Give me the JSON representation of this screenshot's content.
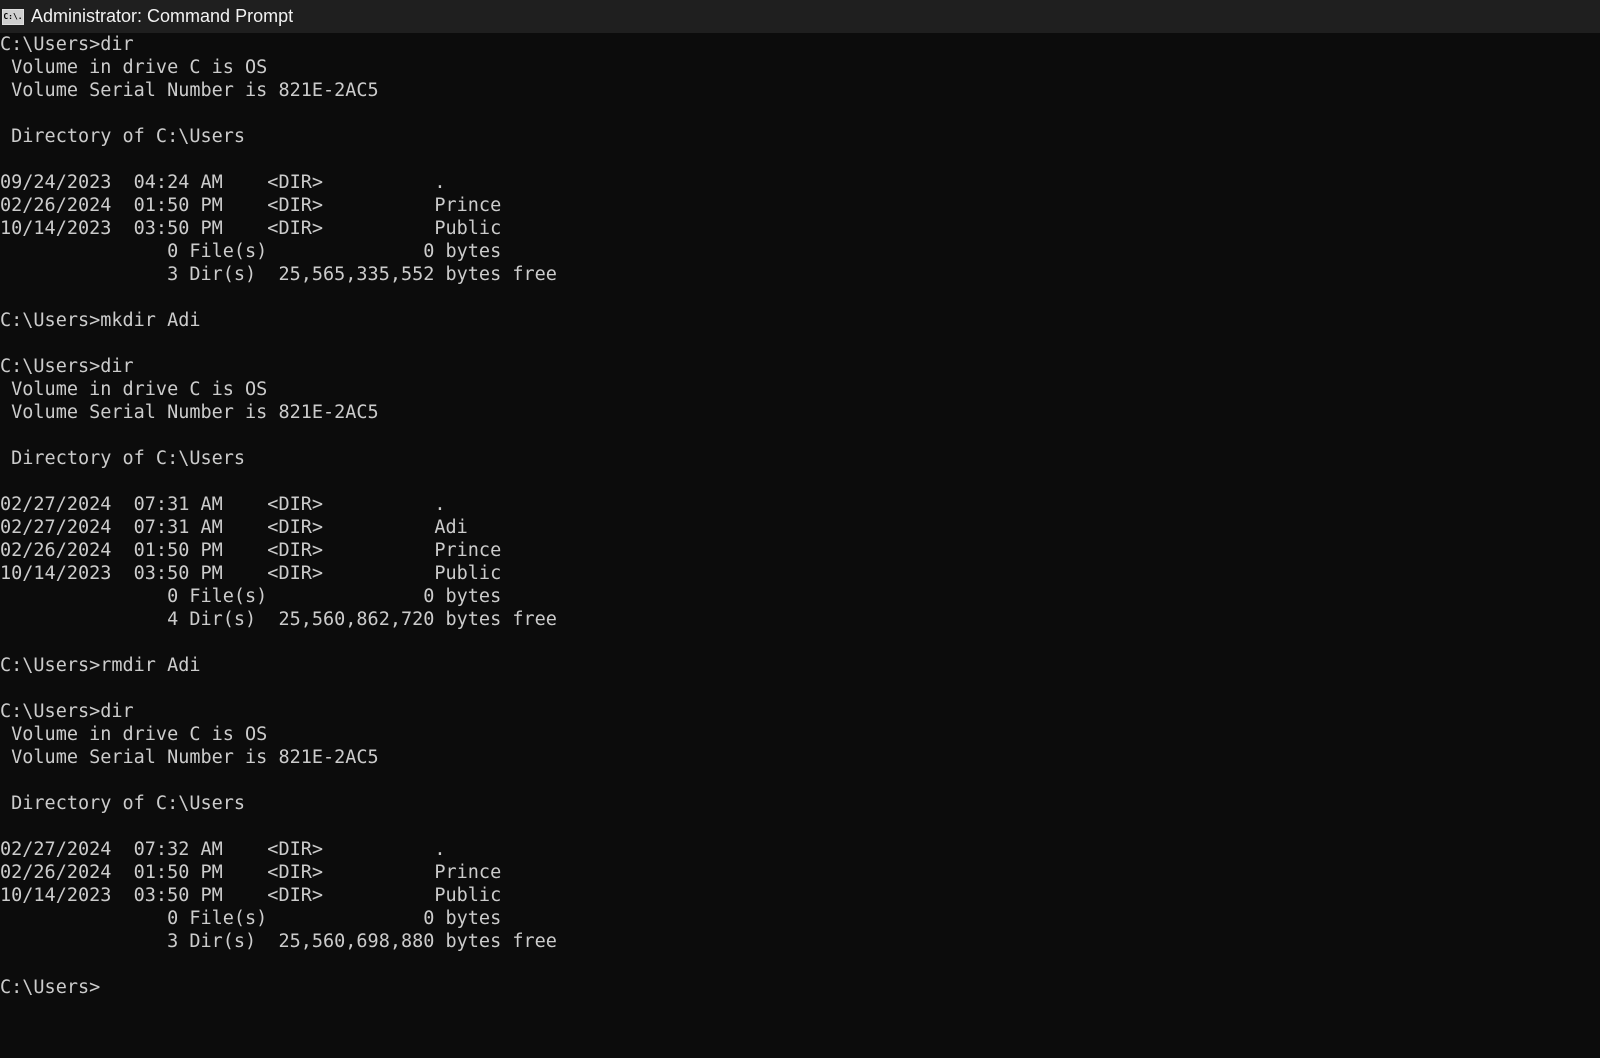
{
  "window": {
    "title": "Administrator: Command Prompt",
    "icon": "cmd-icon",
    "icon_text": "C:\\."
  },
  "colors": {
    "background": "#0c0c0c",
    "titlebar": "#1f1f1f",
    "text": "#cccccc"
  },
  "console": {
    "lines": [
      "C:\\Users>dir",
      " Volume in drive C is OS",
      " Volume Serial Number is 821E-2AC5",
      "",
      " Directory of C:\\Users",
      "",
      "09/24/2023  04:24 AM    <DIR>          .",
      "02/26/2024  01:50 PM    <DIR>          Prince",
      "10/14/2023  03:50 PM    <DIR>          Public",
      "               0 File(s)              0 bytes",
      "               3 Dir(s)  25,565,335,552 bytes free",
      "",
      "C:\\Users>mkdir Adi",
      "",
      "C:\\Users>dir",
      " Volume in drive C is OS",
      " Volume Serial Number is 821E-2AC5",
      "",
      " Directory of C:\\Users",
      "",
      "02/27/2024  07:31 AM    <DIR>          .",
      "02/27/2024  07:31 AM    <DIR>          Adi",
      "02/26/2024  01:50 PM    <DIR>          Prince",
      "10/14/2023  03:50 PM    <DIR>          Public",
      "               0 File(s)              0 bytes",
      "               4 Dir(s)  25,560,862,720 bytes free",
      "",
      "C:\\Users>rmdir Adi",
      "",
      "C:\\Users>dir",
      " Volume in drive C is OS",
      " Volume Serial Number is 821E-2AC5",
      "",
      " Directory of C:\\Users",
      "",
      "02/27/2024  07:32 AM    <DIR>          .",
      "02/26/2024  01:50 PM    <DIR>          Prince",
      "10/14/2023  03:50 PM    <DIR>          Public",
      "               0 File(s)              0 bytes",
      "               3 Dir(s)  25,560,698,880 bytes free",
      "",
      "C:\\Users>"
    ]
  }
}
